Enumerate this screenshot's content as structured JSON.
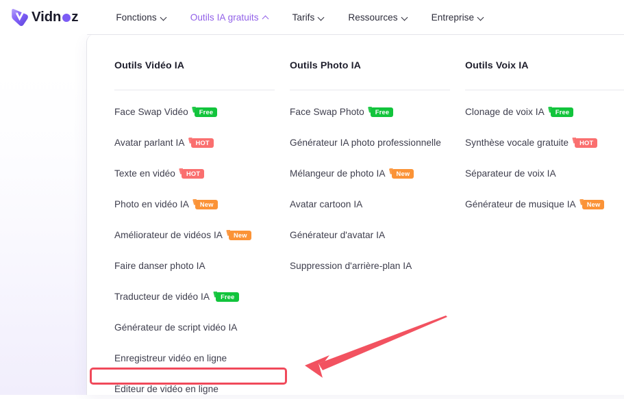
{
  "brand": {
    "name_before": "Vidn",
    "name_after": "z",
    "logo_icon": "vidnoz-v-logo"
  },
  "navbar": {
    "items": [
      {
        "label": "Fonctions",
        "chevron": "chevron-down-icon",
        "active": false
      },
      {
        "label": "Outils IA gratuits",
        "chevron": "chevron-up-icon",
        "active": true
      },
      {
        "label": "Tarifs",
        "chevron": "chevron-down-icon",
        "active": false
      },
      {
        "label": "Ressources",
        "chevron": "chevron-down-icon",
        "active": false
      },
      {
        "label": "Entreprise",
        "chevron": "chevron-down-icon",
        "active": false
      }
    ],
    "active_color": "#9160e8",
    "text_color": "#2c2c3a"
  },
  "dropdown": {
    "columns": [
      {
        "title": "Outils Vidéo IA",
        "items": [
          {
            "label": "Face Swap Vidéo",
            "badge": "Free",
            "badge_type": "free"
          },
          {
            "label": "Avatar parlant IA",
            "badge": "HOT",
            "badge_type": "hot"
          },
          {
            "label": "Texte en vidéo",
            "badge": "HOT",
            "badge_type": "hot"
          },
          {
            "label": "Photo en vidéo IA",
            "badge": "New",
            "badge_type": "new"
          },
          {
            "label": "Améliorateur de vidéos IA",
            "badge": "New",
            "badge_type": "new"
          },
          {
            "label": "Faire danser photo IA",
            "badge": "",
            "badge_type": ""
          },
          {
            "label": "Traducteur de vidéo IA",
            "badge": "Free",
            "badge_type": "free"
          },
          {
            "label": "Générateur de script vidéo IA",
            "badge": "",
            "badge_type": ""
          },
          {
            "label": "Enregistreur vidéo en ligne",
            "badge": "",
            "badge_type": ""
          },
          {
            "label": "Éditeur de vidéo en ligne",
            "badge": "",
            "badge_type": "",
            "highlighted": true
          }
        ]
      },
      {
        "title": "Outils Photo IA",
        "items": [
          {
            "label": "Face Swap Photo",
            "badge": "Free",
            "badge_type": "free"
          },
          {
            "label": "Générateur IA photo professionnelle",
            "badge": "",
            "badge_type": ""
          },
          {
            "label": "Mélangeur de photo IA",
            "badge": "New",
            "badge_type": "new"
          },
          {
            "label": "Avatar cartoon IA",
            "badge": "",
            "badge_type": ""
          },
          {
            "label": "Générateur d'avatar IA",
            "badge": "",
            "badge_type": ""
          },
          {
            "label": "Suppression d'arrière-plan IA",
            "badge": "",
            "badge_type": ""
          }
        ]
      },
      {
        "title": "Outils Voix IA",
        "items": [
          {
            "label": "Clonage de voix IA",
            "badge": "Free",
            "badge_type": "free"
          },
          {
            "label": "Synthèse vocale gratuite",
            "badge": "HOT",
            "badge_type": "hot"
          },
          {
            "label": "Séparateur de voix IA",
            "badge": "",
            "badge_type": ""
          },
          {
            "label": "Générateur de musique IA",
            "badge": "New",
            "badge_type": "new"
          }
        ]
      }
    ]
  },
  "annotations": {
    "highlight_color": "#f0495a",
    "arrow_color": "#f25260",
    "highlight_target": "Éditeur de vidéo en ligne"
  },
  "badge_colors": {
    "free": "#12c43c",
    "hot": "#fa6f6f",
    "new": "#fb9337"
  }
}
